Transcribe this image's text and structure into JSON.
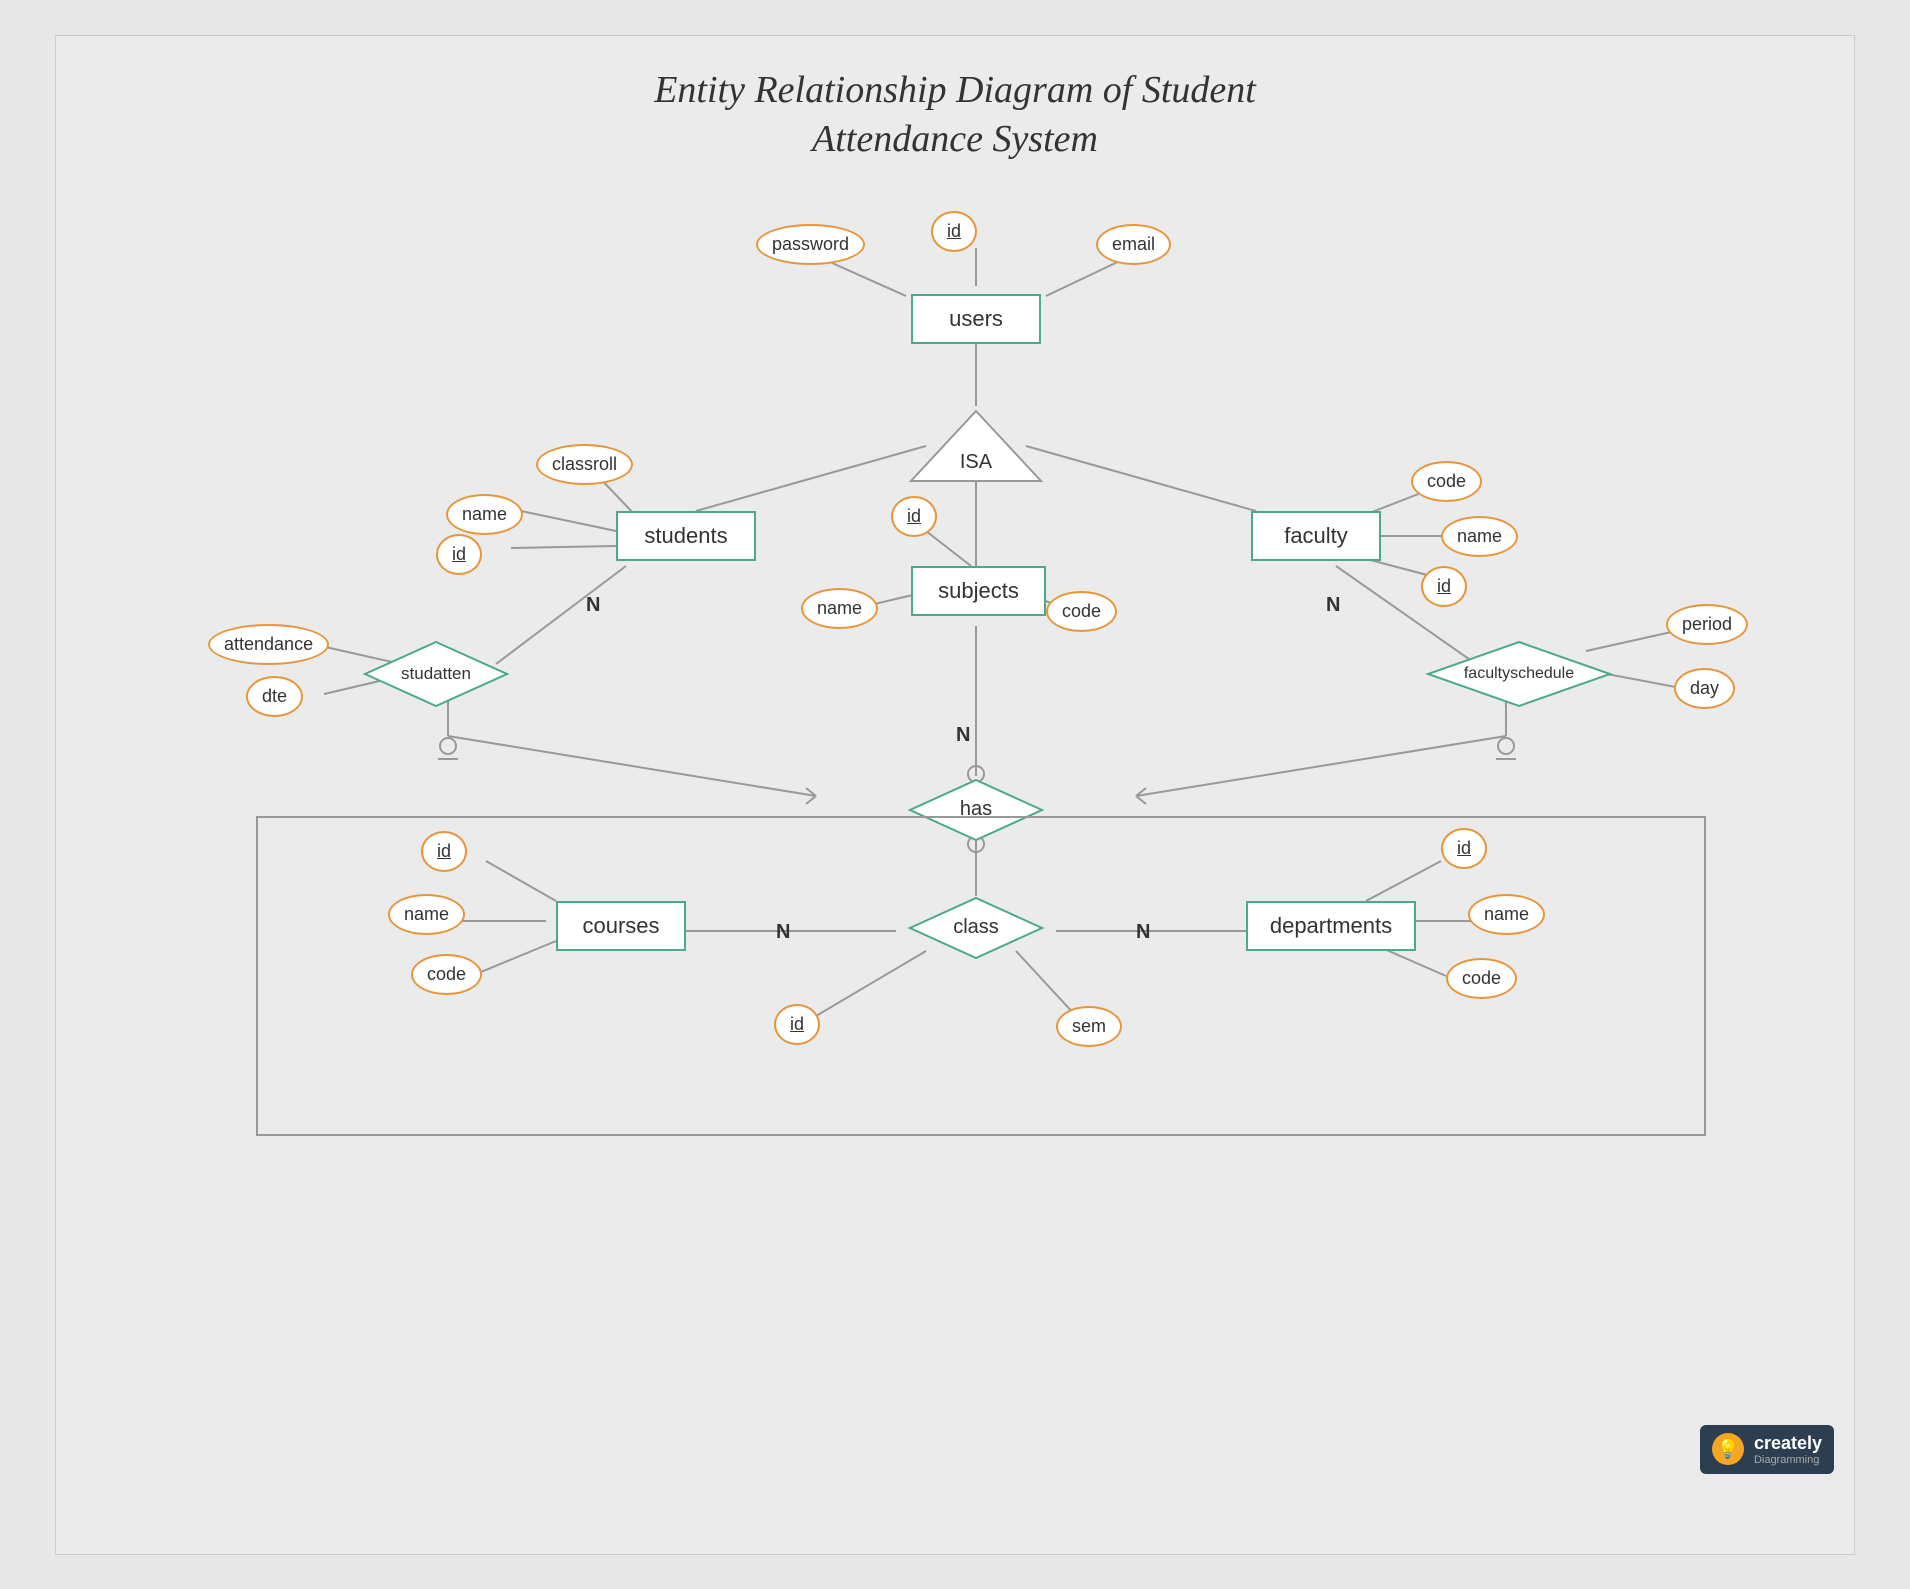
{
  "title": {
    "line1": "Entity Relationship Diagram of Student",
    "line2": "Attendance System"
  },
  "entities": {
    "users": "users",
    "students": "students",
    "faculty": "faculty",
    "subjects": "subjects",
    "courses": "courses",
    "departments": "departments",
    "class": "class"
  },
  "attributes": {
    "id_users": "id",
    "password": "password",
    "email": "email",
    "name_students": "name",
    "classroll": "classroll",
    "id_students": "id",
    "code_faculty": "code",
    "name_faculty": "name",
    "id_faculty": "id",
    "id_subjects": "id",
    "name_subjects": "name",
    "code_subjects": "code",
    "attendance": "attendance",
    "dte": "dte",
    "period": "period",
    "day": "day",
    "id_courses": "id",
    "name_courses": "name",
    "code_courses": "code",
    "id_dept": "id",
    "name_dept": "name",
    "code_dept": "code",
    "id_class": "id",
    "sem": "sem"
  },
  "relationships": {
    "isa": "ISA",
    "studatten": "studatten",
    "facultyschedule": "facultyschedule",
    "has": "has",
    "class_rel": "class"
  },
  "multiplicities": {
    "n1": "N",
    "n2": "N",
    "n3": "N",
    "n4": "N"
  },
  "logo": {
    "name": "creately",
    "sub": "Diagramming"
  }
}
